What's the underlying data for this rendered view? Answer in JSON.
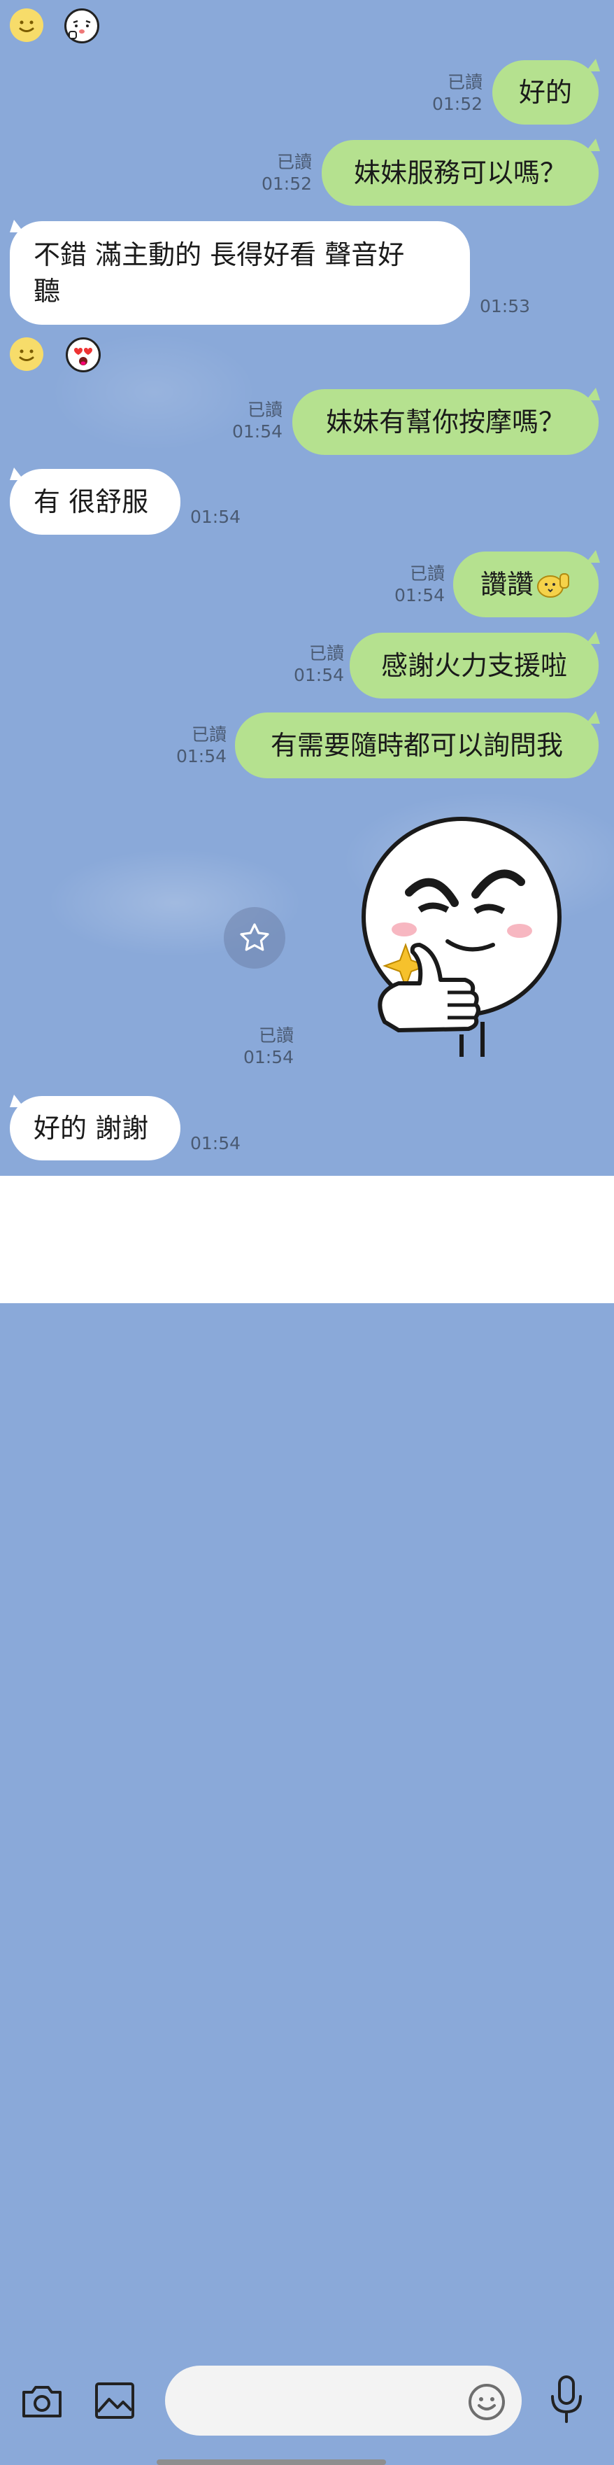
{
  "chat": {
    "m1": {
      "text": "好的",
      "read": "已讀",
      "time": "01:52"
    },
    "m2": {
      "text": "妹妹服務可以嗎？",
      "read": "已讀",
      "time": "01:52"
    },
    "m3": {
      "line1": "不錯 滿主動的 長得好看 聲音好",
      "line2": "聽",
      "time": "01:53"
    },
    "m4": {
      "text": "妹妹有幫你按摩嗎？",
      "read": "已讀",
      "time": "01:54"
    },
    "m5": {
      "text": "有 很舒服",
      "time": "01:54"
    },
    "m6": {
      "text": "讚讚",
      "read": "已讀",
      "time": "01:54"
    },
    "m7": {
      "text": "感謝火力支援啦",
      "read": "已讀",
      "time": "01:54"
    },
    "m8": {
      "text": "有需要隨時都可以詢問我",
      "read": "已讀",
      "time": "01:54"
    },
    "sticker": {
      "read": "已讀",
      "time": "01:54"
    },
    "m9": {
      "text": "好的 謝謝",
      "time": "01:54"
    }
  },
  "input": {
    "placeholder": ""
  },
  "icons": {
    "camera": "camera-icon",
    "image": "image-icon",
    "emoji": "emoji-icon",
    "mic": "microphone-icon",
    "star": "star-icon"
  },
  "colors": {
    "background": "#8aa9d9",
    "outgoing_bubble": "#b5e18f",
    "incoming_bubble": "#ffffff"
  }
}
